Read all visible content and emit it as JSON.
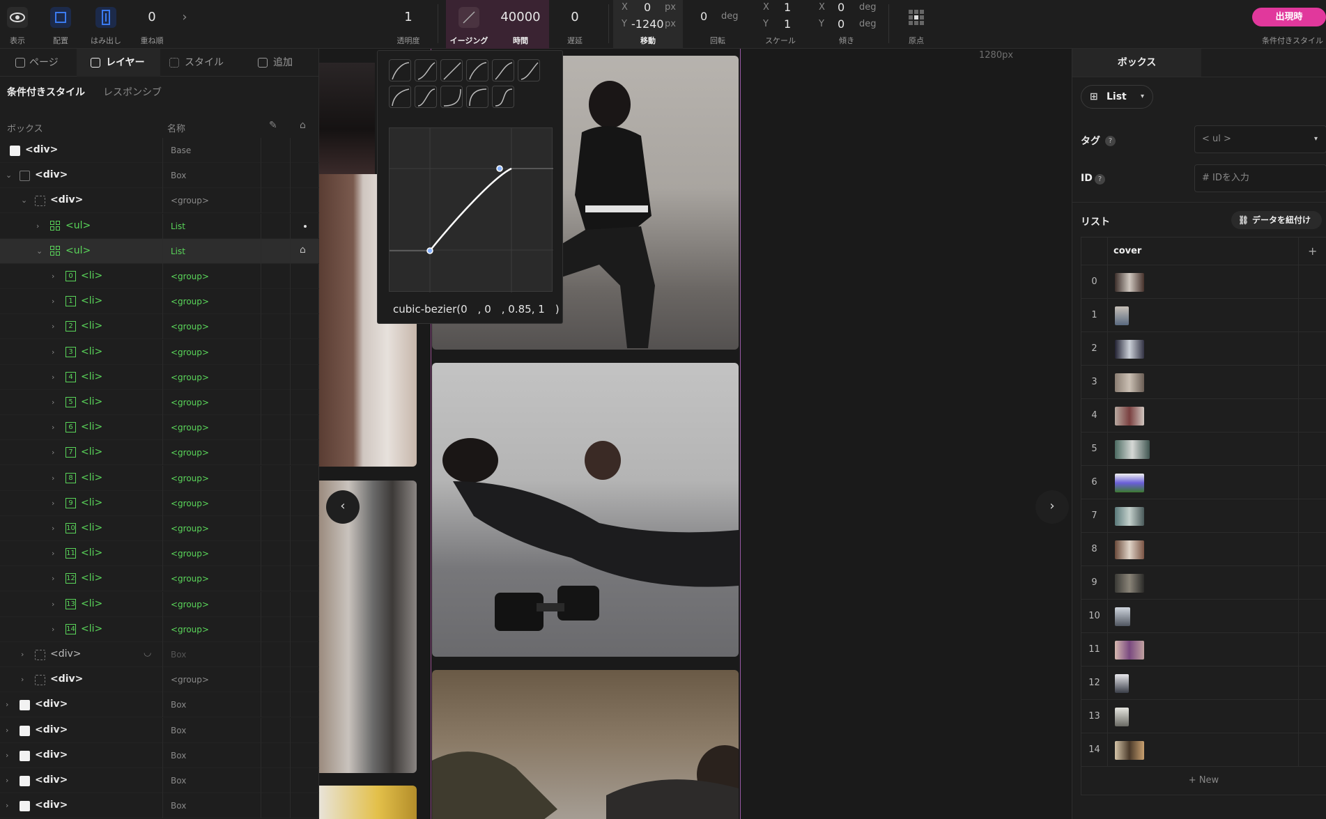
{
  "toolbar": {
    "view_label": "表示",
    "arrange_label": "配置",
    "overflow_label": "はみ出し",
    "overlap_label": "重ね順",
    "overlap_value": "0",
    "more_arrow": "›",
    "opacity_value": "1",
    "opacity_label": "透明度",
    "easing_label": "イージング",
    "duration_value": "40000",
    "duration_label": "時間",
    "delay_value": "0",
    "delay_label": "遅延",
    "move_x_axis": "X",
    "move_x_value": "0",
    "move_x_unit": "px",
    "move_y_axis": "Y",
    "move_y_value": "-1240",
    "move_y_unit": "px",
    "move_label": "移動",
    "rotate_value": "0",
    "rotate_unit": "deg",
    "rotate_label": "回転",
    "scale_x_axis": "X",
    "scale_x_value": "1",
    "scale_y_axis": "Y",
    "scale_y_value": "1",
    "scale_label": "スケール",
    "skew_x_axis": "X",
    "skew_x_value": "0",
    "skew_x_unit": "deg",
    "skew_y_axis": "Y",
    "skew_y_value": "0",
    "skew_y_unit": "deg",
    "skew_label": "傾き",
    "origin_label": "原点",
    "appear_button": "出現時",
    "conditional_style_label": "条件付きスタイル"
  },
  "left_panel": {
    "tabs": [
      {
        "label": "ページ"
      },
      {
        "label": "レイヤー"
      },
      {
        "label": "スタイル"
      },
      {
        "label": "追加"
      }
    ],
    "subtabs": [
      {
        "label": "条件付きスタイル"
      },
      {
        "label": "レスポンシブ"
      }
    ],
    "col_box": "ボックス",
    "col_name": "名称",
    "rows": [
      {
        "tag": "<div>",
        "name": "Base"
      },
      {
        "tag": "<div>",
        "name": "Box"
      },
      {
        "tag": "<div>",
        "name": "<group>"
      },
      {
        "tag": "<ul>",
        "name": "List"
      },
      {
        "tag": "<ul>",
        "name": "List"
      },
      {
        "num": "0",
        "tag": "<li>",
        "name": "<group>"
      },
      {
        "num": "1",
        "tag": "<li>",
        "name": "<group>"
      },
      {
        "num": "2",
        "tag": "<li>",
        "name": "<group>"
      },
      {
        "num": "3",
        "tag": "<li>",
        "name": "<group>"
      },
      {
        "num": "4",
        "tag": "<li>",
        "name": "<group>"
      },
      {
        "num": "5",
        "tag": "<li>",
        "name": "<group>"
      },
      {
        "num": "6",
        "tag": "<li>",
        "name": "<group>"
      },
      {
        "num": "7",
        "tag": "<li>",
        "name": "<group>"
      },
      {
        "num": "8",
        "tag": "<li>",
        "name": "<group>"
      },
      {
        "num": "9",
        "tag": "<li>",
        "name": "<group>"
      },
      {
        "num": "10",
        "tag": "<li>",
        "name": "<group>"
      },
      {
        "num": "11",
        "tag": "<li>",
        "name": "<group>"
      },
      {
        "num": "12",
        "tag": "<li>",
        "name": "<group>"
      },
      {
        "num": "13",
        "tag": "<li>",
        "name": "<group>"
      },
      {
        "num": "14",
        "tag": "<li>",
        "name": "<group>"
      },
      {
        "tag": "<div>",
        "name": "Box"
      },
      {
        "tag": "<div>",
        "name": "<group>"
      },
      {
        "tag": "<div>",
        "name": "Box"
      },
      {
        "tag": "<div>",
        "name": "Box"
      },
      {
        "tag": "<div>",
        "name": "Box"
      },
      {
        "tag": "<div>",
        "name": "Box"
      },
      {
        "tag": "<div>",
        "name": "Box"
      }
    ]
  },
  "canvas": {
    "ruler_label": "1280px",
    "prev_arrow": "‹",
    "next_arrow": "›"
  },
  "easing_popup": {
    "bezier_text": "cubic-bezier(0　, 0　, 0.85, 1　)"
  },
  "right_panel": {
    "tab_label": "ボックス",
    "list_button": "List",
    "tag_label": "タグ",
    "tag_value": "< ul >",
    "id_label": "ID",
    "id_placeholder": "# IDを入力",
    "list_label": "リスト",
    "link_data_button": "データを紐付け",
    "column_header": "cover",
    "add_column": "+",
    "items": [
      {
        "index": "0"
      },
      {
        "index": "1"
      },
      {
        "index": "2"
      },
      {
        "index": "3"
      },
      {
        "index": "4"
      },
      {
        "index": "5"
      },
      {
        "index": "6"
      },
      {
        "index": "7"
      },
      {
        "index": "8"
      },
      {
        "index": "9"
      },
      {
        "index": "10"
      },
      {
        "index": "11"
      },
      {
        "index": "12"
      },
      {
        "index": "13"
      },
      {
        "index": "14"
      }
    ],
    "new_button": "+ New"
  },
  "colors": {
    "accent_pink": "#e1389c",
    "layer_green": "#5ad65a",
    "ruler_purple": "#9a5aa6"
  }
}
